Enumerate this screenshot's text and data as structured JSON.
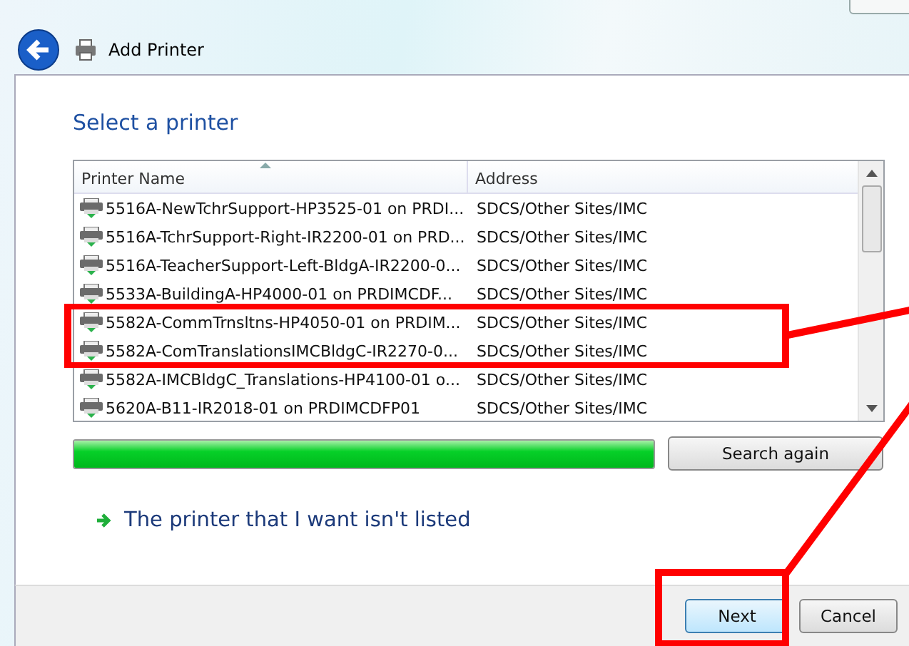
{
  "window": {
    "title": "Add Printer"
  },
  "heading": "Select a printer",
  "table": {
    "columns": [
      "Printer Name",
      "Address"
    ],
    "rows": [
      {
        "name": "5516A-NewTchrSupport-HP3525-01 on PRDI...",
        "address": "SDCS/Other Sites/IMC"
      },
      {
        "name": "5516A-TchrSupport-Right-IR2200-01 on PRD...",
        "address": "SDCS/Other Sites/IMC"
      },
      {
        "name": "5516A-TeacherSupport-Left-BldgA-IR2200-0...",
        "address": "SDCS/Other Sites/IMC"
      },
      {
        "name": "5533A-BuildingA-HP4000-01 on PRDIMCDF...",
        "address": "SDCS/Other Sites/IMC"
      },
      {
        "name": "5582A-CommTrnsltns-HP4050-01 on PRDIM...",
        "address": "SDCS/Other Sites/IMC"
      },
      {
        "name": "5582A-ComTranslationsIMCBldgC-IR2270-0...",
        "address": "SDCS/Other Sites/IMC"
      },
      {
        "name": "5582A-IMCBldgC_Translations-HP4100-01 o...",
        "address": "SDCS/Other Sites/IMC"
      },
      {
        "name": "5620A-B11-IR2018-01 on PRDIMCDFP01",
        "address": "SDCS/Other Sites/IMC"
      }
    ]
  },
  "progress": {
    "level": 1
  },
  "search_button": "Search again",
  "not_listed_link": "The printer that I want isn't listed",
  "buttons": [
    {
      "label": "Next",
      "kind": "default"
    },
    {
      "label": "Cancel",
      "kind": "normal"
    }
  ]
}
